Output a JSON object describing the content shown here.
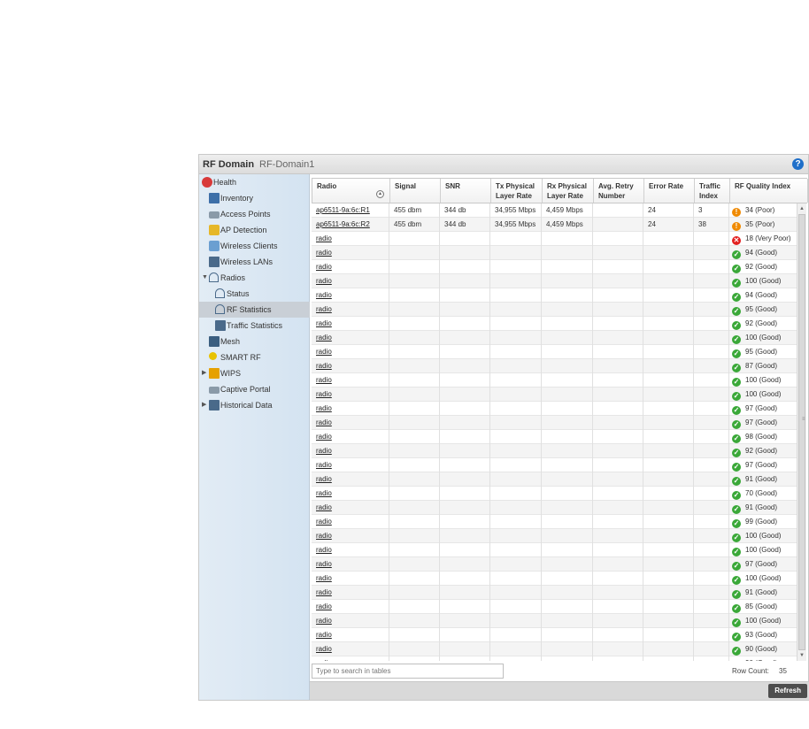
{
  "header": {
    "title": "RF Domain",
    "domain_name": "RF-Domain1",
    "help_icon": "?"
  },
  "sidebar": {
    "items": [
      {
        "label": "Health",
        "icon": "health-icon"
      },
      {
        "label": "Inventory",
        "icon": "inventory-icon"
      },
      {
        "label": "Access Points",
        "icon": "access-points-icon"
      },
      {
        "label": "AP Detection",
        "icon": "ap-detection-icon"
      },
      {
        "label": "Wireless Clients",
        "icon": "wireless-clients-icon"
      },
      {
        "label": "Wireless LANs",
        "icon": "wireless-lans-icon"
      },
      {
        "label": "Radios",
        "icon": "radio-icon",
        "expanded": true
      },
      {
        "label": "Status",
        "icon": "radio-icon"
      },
      {
        "label": "RF Statistics",
        "icon": "radio-icon",
        "selected": true
      },
      {
        "label": "Traffic Statistics",
        "icon": "traffic-icon"
      },
      {
        "label": "Mesh",
        "icon": "mesh-icon"
      },
      {
        "label": "SMART RF",
        "icon": "smart-rf-icon"
      },
      {
        "label": "WIPS",
        "icon": "wips-icon",
        "collapsed": true
      },
      {
        "label": "Captive Portal",
        "icon": "captive-portal-icon"
      },
      {
        "label": "Historical Data",
        "icon": "historical-data-icon",
        "collapsed": true
      }
    ]
  },
  "table": {
    "columns": [
      {
        "label": "Radio"
      },
      {
        "label": "Signal"
      },
      {
        "label": "SNR"
      },
      {
        "label": "Tx Physical Layer Rate"
      },
      {
        "label": "Rx Physical Layer Rate"
      },
      {
        "label": "Avg. Retry Number"
      },
      {
        "label": "Error Rate"
      },
      {
        "label": "Traffic Index"
      },
      {
        "label": "RF Quality Index"
      }
    ],
    "rows": [
      {
        "radio": "ap6511-9a:6c:R1",
        "signal": "455 dbm",
        "snr": "344 db",
        "tx": "34,955 Mbps",
        "rx": "4,459 Mbps",
        "retry": "",
        "error": "24",
        "traffic": "3",
        "quality": "34 (Poor)",
        "status": "poor"
      },
      {
        "radio": "ap6511-9a:6c:R2",
        "signal": "455 dbm",
        "snr": "344 db",
        "tx": "34,955 Mbps",
        "rx": "4,459 Mbps",
        "retry": "",
        "error": "24",
        "traffic": "38",
        "quality": "35 (Poor)",
        "status": "poor"
      },
      {
        "radio": "radio",
        "signal": "",
        "snr": "",
        "tx": "",
        "rx": "",
        "retry": "",
        "error": "",
        "traffic": "",
        "quality": "18 (Very Poor)",
        "status": "very-poor"
      },
      {
        "radio": "radio",
        "signal": "",
        "snr": "",
        "tx": "",
        "rx": "",
        "retry": "",
        "error": "",
        "traffic": "",
        "quality": "94 (Good)",
        "status": "good"
      },
      {
        "radio": "radio",
        "signal": "",
        "snr": "",
        "tx": "",
        "rx": "",
        "retry": "",
        "error": "",
        "traffic": "",
        "quality": "92 (Good)",
        "status": "good"
      },
      {
        "radio": "radio",
        "signal": "",
        "snr": "",
        "tx": "",
        "rx": "",
        "retry": "",
        "error": "",
        "traffic": "",
        "quality": "100 (Good)",
        "status": "good"
      },
      {
        "radio": "radio",
        "signal": "",
        "snr": "",
        "tx": "",
        "rx": "",
        "retry": "",
        "error": "",
        "traffic": "",
        "quality": "94 (Good)",
        "status": "good"
      },
      {
        "radio": "radio",
        "signal": "",
        "snr": "",
        "tx": "",
        "rx": "",
        "retry": "",
        "error": "",
        "traffic": "",
        "quality": "95 (Good)",
        "status": "good"
      },
      {
        "radio": "radio",
        "signal": "",
        "snr": "",
        "tx": "",
        "rx": "",
        "retry": "",
        "error": "",
        "traffic": "",
        "quality": "92 (Good)",
        "status": "good"
      },
      {
        "radio": "radio",
        "signal": "",
        "snr": "",
        "tx": "",
        "rx": "",
        "retry": "",
        "error": "",
        "traffic": "",
        "quality": "100 (Good)",
        "status": "good"
      },
      {
        "radio": "radio",
        "signal": "",
        "snr": "",
        "tx": "",
        "rx": "",
        "retry": "",
        "error": "",
        "traffic": "",
        "quality": "95 (Good)",
        "status": "good"
      },
      {
        "radio": "radio",
        "signal": "",
        "snr": "",
        "tx": "",
        "rx": "",
        "retry": "",
        "error": "",
        "traffic": "",
        "quality": "87 (Good)",
        "status": "good"
      },
      {
        "radio": "radio",
        "signal": "",
        "snr": "",
        "tx": "",
        "rx": "",
        "retry": "",
        "error": "",
        "traffic": "",
        "quality": "100 (Good)",
        "status": "good"
      },
      {
        "radio": "radio",
        "signal": "",
        "snr": "",
        "tx": "",
        "rx": "",
        "retry": "",
        "error": "",
        "traffic": "",
        "quality": "100 (Good)",
        "status": "good"
      },
      {
        "radio": "radio",
        "signal": "",
        "snr": "",
        "tx": "",
        "rx": "",
        "retry": "",
        "error": "",
        "traffic": "",
        "quality": "97 (Good)",
        "status": "good"
      },
      {
        "radio": "radio",
        "signal": "",
        "snr": "",
        "tx": "",
        "rx": "",
        "retry": "",
        "error": "",
        "traffic": "",
        "quality": "97 (Good)",
        "status": "good"
      },
      {
        "radio": "radio",
        "signal": "",
        "snr": "",
        "tx": "",
        "rx": "",
        "retry": "",
        "error": "",
        "traffic": "",
        "quality": "98 (Good)",
        "status": "good"
      },
      {
        "radio": "radio",
        "signal": "",
        "snr": "",
        "tx": "",
        "rx": "",
        "retry": "",
        "error": "",
        "traffic": "",
        "quality": "92 (Good)",
        "status": "good"
      },
      {
        "radio": "radio",
        "signal": "",
        "snr": "",
        "tx": "",
        "rx": "",
        "retry": "",
        "error": "",
        "traffic": "",
        "quality": "97 (Good)",
        "status": "good"
      },
      {
        "radio": "radio",
        "signal": "",
        "snr": "",
        "tx": "",
        "rx": "",
        "retry": "",
        "error": "",
        "traffic": "",
        "quality": "91 (Good)",
        "status": "good"
      },
      {
        "radio": "radio",
        "signal": "",
        "snr": "",
        "tx": "",
        "rx": "",
        "retry": "",
        "error": "",
        "traffic": "",
        "quality": "70 (Good)",
        "status": "good"
      },
      {
        "radio": "radio",
        "signal": "",
        "snr": "",
        "tx": "",
        "rx": "",
        "retry": "",
        "error": "",
        "traffic": "",
        "quality": "91 (Good)",
        "status": "good"
      },
      {
        "radio": "radio",
        "signal": "",
        "snr": "",
        "tx": "",
        "rx": "",
        "retry": "",
        "error": "",
        "traffic": "",
        "quality": "99 (Good)",
        "status": "good"
      },
      {
        "radio": "radio",
        "signal": "",
        "snr": "",
        "tx": "",
        "rx": "",
        "retry": "",
        "error": "",
        "traffic": "",
        "quality": "100 (Good)",
        "status": "good"
      },
      {
        "radio": "radio",
        "signal": "",
        "snr": "",
        "tx": "",
        "rx": "",
        "retry": "",
        "error": "",
        "traffic": "",
        "quality": "100 (Good)",
        "status": "good"
      },
      {
        "radio": "radio",
        "signal": "",
        "snr": "",
        "tx": "",
        "rx": "",
        "retry": "",
        "error": "",
        "traffic": "",
        "quality": "97 (Good)",
        "status": "good"
      },
      {
        "radio": "radio",
        "signal": "",
        "snr": "",
        "tx": "",
        "rx": "",
        "retry": "",
        "error": "",
        "traffic": "",
        "quality": "100 (Good)",
        "status": "good"
      },
      {
        "radio": "radio",
        "signal": "",
        "snr": "",
        "tx": "",
        "rx": "",
        "retry": "",
        "error": "",
        "traffic": "",
        "quality": "91 (Good)",
        "status": "good"
      },
      {
        "radio": "radio",
        "signal": "",
        "snr": "",
        "tx": "",
        "rx": "",
        "retry": "",
        "error": "",
        "traffic": "",
        "quality": "85 (Good)",
        "status": "good"
      },
      {
        "radio": "radio",
        "signal": "",
        "snr": "",
        "tx": "",
        "rx": "",
        "retry": "",
        "error": "",
        "traffic": "",
        "quality": "100 (Good)",
        "status": "good"
      },
      {
        "radio": "radio",
        "signal": "",
        "snr": "",
        "tx": "",
        "rx": "",
        "retry": "",
        "error": "",
        "traffic": "",
        "quality": "93 (Good)",
        "status": "good"
      },
      {
        "radio": "radio",
        "signal": "",
        "snr": "",
        "tx": "",
        "rx": "",
        "retry": "",
        "error": "",
        "traffic": "",
        "quality": "90 (Good)",
        "status": "good"
      },
      {
        "radio": "radio",
        "signal": "",
        "snr": "",
        "tx": "",
        "rx": "",
        "retry": "",
        "error": "",
        "traffic": "",
        "quality": "90 (Good)",
        "status": "good"
      }
    ]
  },
  "search": {
    "placeholder": "Type to search in tables"
  },
  "footer": {
    "row_count_label": "Row Count:",
    "row_count": "35",
    "refresh_label": "Refresh"
  },
  "colors": {
    "good": "#3aa838",
    "poor": "#f08a00",
    "very_poor": "#e32020",
    "accent": "#1f6fc9"
  }
}
